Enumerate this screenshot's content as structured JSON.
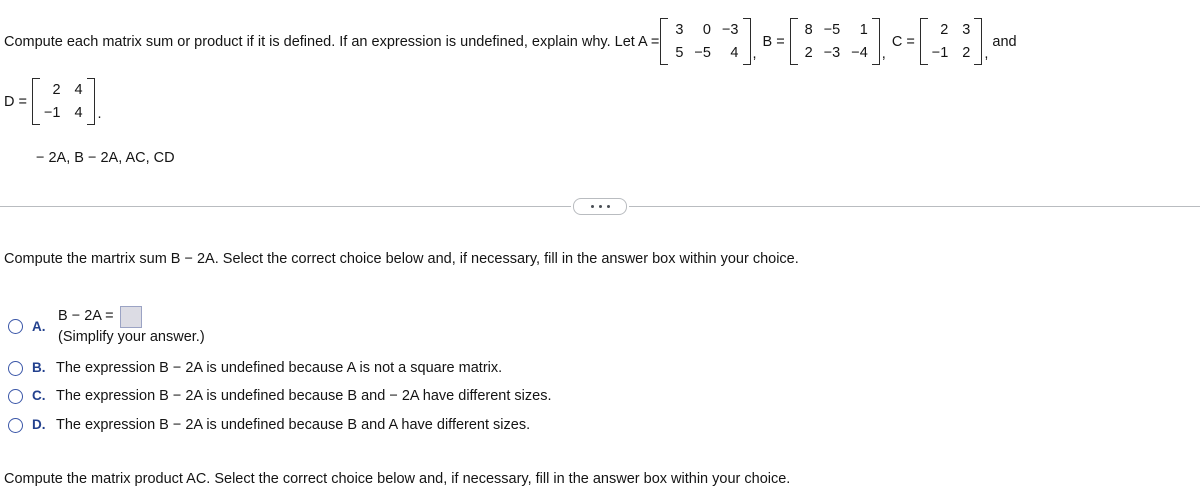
{
  "problem": {
    "stem_part1": "Compute each matrix sum or product if it is defined. If an expression is undefined, explain why. Let A =",
    "matrices": [
      {
        "name": "A",
        "label": "",
        "rows": [
          [
            "3",
            "0",
            "−3"
          ],
          [
            "5",
            "−5",
            "4"
          ]
        ],
        "trailing": ","
      },
      {
        "name": "B",
        "label": "B =",
        "rows": [
          [
            "8",
            "−5",
            "1"
          ],
          [
            "2",
            "−3",
            "−4"
          ]
        ],
        "trailing": ","
      },
      {
        "name": "C",
        "label": "C =",
        "rows": [
          [
            "2",
            "3"
          ],
          [
            "−1",
            "2"
          ]
        ],
        "trailing": ","
      }
    ],
    "and_word": "and",
    "d_label": "D =",
    "d_rows": [
      [
        "2",
        "4"
      ],
      [
        "−1",
        "4"
      ]
    ],
    "d_period": ".",
    "expression_list": "− 2A, B − 2A, AC, CD"
  },
  "divider": {
    "ellipsis_label": "more-options"
  },
  "question_1": {
    "prompt": "Compute the martrix sum B − 2A. Select the correct choice below and, if necessary, fill in the answer box within your choice.",
    "choices": [
      {
        "letter": "A.",
        "expression": "B − 2A =",
        "answer_value": "",
        "note": "(Simplify your answer.)"
      },
      {
        "letter": "B.",
        "text": "The expression B − 2A is undefined because A is not a square matrix."
      },
      {
        "letter": "C.",
        "text": "The expression B − 2A is undefined because B and  − 2A have different sizes."
      },
      {
        "letter": "D.",
        "text": "The expression B − 2A is undefined because B and A have different sizes."
      }
    ]
  },
  "question_2": {
    "prompt": "Compute the matrix product AC. Select the correct choice below and, if necessary, fill in the answer box within your choice."
  },
  "colors": {
    "accent_blue": "#23418e",
    "radio_border": "#3b57a8",
    "answer_box_fill": "#dcdce4",
    "answer_box_border": "#9ba3c4",
    "divider_line": "#b9bcc0",
    "text": "#141414"
  }
}
